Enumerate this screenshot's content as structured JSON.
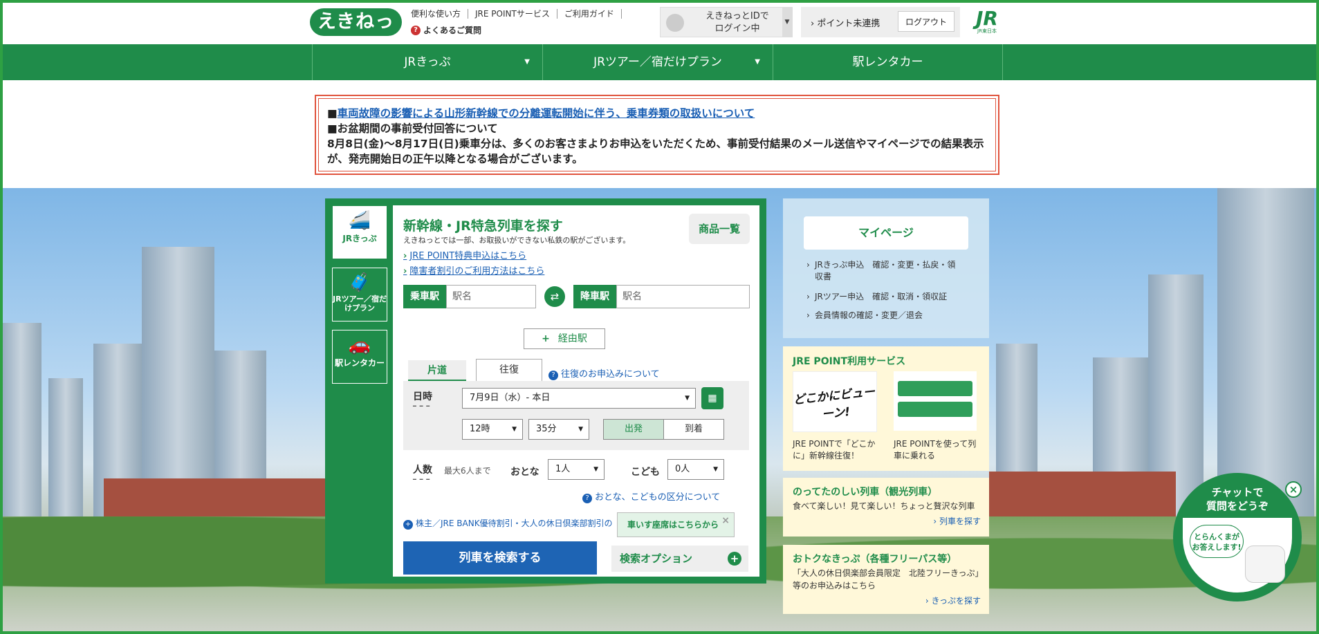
{
  "header": {
    "logo_text": "えきねっと",
    "links": [
      "便利な使い方",
      "JRE POINTサービス",
      "ご利用ガイド"
    ],
    "faq_label": "よくあるご質問",
    "id_status_line1": "えきねっとIDで",
    "id_status_line2": "ログイン中",
    "point_status": "ポイント未連携",
    "logout_label": "ログアウト",
    "jr_logo": "JR",
    "jr_sub": "JR東日本"
  },
  "nav": {
    "items": [
      "JRきっぷ",
      "JRツアー／宿だけプラン",
      "駅レンタカー"
    ]
  },
  "notice": {
    "link_text": "車両故障の影響による山形新幹線での分離運転開始に伴う、乗車券類の取扱いについて",
    "heading": "■お盆期間の事前受付回答について",
    "body": "8月8日(金)～8月17日(日)乗車分は、多くのお客さまよりお申込をいただくため、事前受付結果のメール送信やマイページでの結果表示が、発売開始日の正午以降となる場合がございます。"
  },
  "search": {
    "side_tabs": [
      "JRきっぷ",
      "JRツアー／宿だけプラン",
      "駅レンタカー"
    ],
    "title": "新幹線・JR特急列車を探す",
    "note": "えきねっとでは一部、お取扱いができない私鉄の駅がございます。",
    "link1": "JRE POINT特典申込はこちら",
    "link2": "障害者割引のご利用方法はこちら",
    "product_list": "商品一覧",
    "from_label": "乗車駅",
    "from_placeholder": "駅名",
    "to_label": "降車駅",
    "to_placeholder": "駅名",
    "via_label": "経由駅",
    "trip_oneway": "片道",
    "trip_round": "往復",
    "trip_help": "往復のお申込みについて",
    "date_label": "日時",
    "date_value": "7月9日（水）- 本日",
    "hour_value": "12時",
    "minute_value": "35分",
    "depart": "出発",
    "arrive": "到着",
    "pax_label": "人数",
    "pax_max": "最大6人まで",
    "adult_label": "おとな",
    "adult_value": "1人",
    "child_label": "こども",
    "child_value": "0人",
    "age_help": "おとな、こどもの区分について",
    "discount_link": "株主／JRE BANK優待割引・大人の休日倶楽部割引の",
    "tooltip": "車いす座席はこちらから",
    "search_btn": "列車を検索する",
    "options_btn": "検索オプション"
  },
  "mypage": {
    "button": "マイページ",
    "links": [
      "JRきっぷ申込　確認・変更・払戻・領収書",
      "JRツアー申込　確認・取消・領収証",
      "会員情報の確認・変更／退会"
    ]
  },
  "jre": {
    "title": "JRE POINT利用サービス",
    "card1_img": "どこかにビューーン!",
    "card1_caption": "JRE POINTで「どこかに」新幹線往復！",
    "card2_caption": "JRE POINTを使って列車に乗れる"
  },
  "promo1": {
    "title": "のってたのしい列車（観光列車）",
    "text": "食べて楽しい！見て楽しい！ちょっと贅沢な列車",
    "link": "列車を探す"
  },
  "promo2": {
    "title": "おトクなきっぷ（各種フリーパス等）",
    "text": "「大人の休日倶楽部会員限定　北陸フリーきっぷ」等のお申込みはこちら",
    "link": "きっぷを探す"
  },
  "chat": {
    "title_line1": "チャットで",
    "title_line2": "質問をどうぞ",
    "bubble_line1": "とらんくまが",
    "bubble_line2": "お答えします!"
  }
}
